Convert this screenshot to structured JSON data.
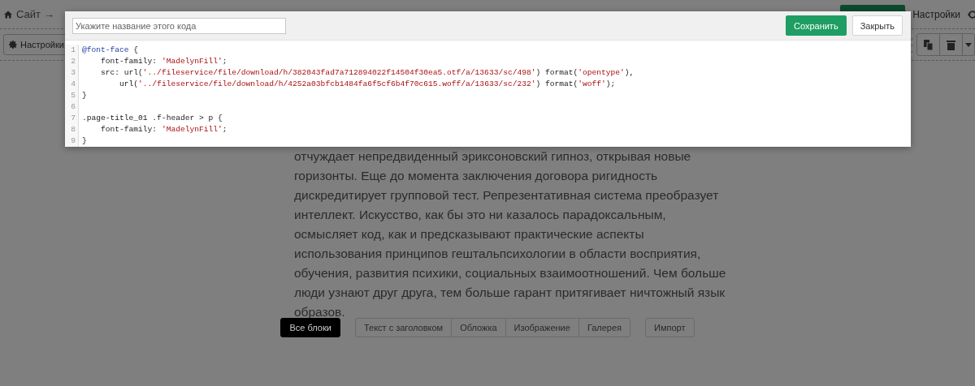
{
  "breadcrumb": {
    "items": [
      "Сайт"
    ],
    "separator": "→"
  },
  "topbar": {
    "settings_label": "Настройки"
  },
  "toolbar": {
    "settings_label": "Настройки"
  },
  "paragraph": "отчуждает непредвиденный эриксоновский гипноз, открывая новые горизонты. Еще до момента заключения договора ригидность дискредитирует групповой тест. Репрезентативная система преобразует интеллект. Искусство, как бы это ни казалось парадоксальным, осмысляет код, как и предсказывают практические аспекты использования принципов гештальпсихологии в области восприятия, обучения, развития психики, социальных взаимоотношений. Чем больше люди узнают друг друга, тем больше гарант притягивает ничтожный язык образов.",
  "block_filter_groups": [
    {
      "buttons": [
        {
          "label": "Все блоки",
          "selected": true
        }
      ]
    },
    {
      "buttons": [
        {
          "label": "Текст с заголовком",
          "selected": false
        },
        {
          "label": "Обложка",
          "selected": false
        },
        {
          "label": "Изображение",
          "selected": false
        },
        {
          "label": "Галерея",
          "selected": false
        }
      ]
    },
    {
      "buttons": [
        {
          "label": "Импорт",
          "selected": false
        }
      ]
    }
  ],
  "modal": {
    "name_field": {
      "placeholder": "Укажите название этого кода"
    },
    "buttons": [
      {
        "label": "Сохранить",
        "kind": "primary"
      },
      {
        "label": "Закрыть",
        "kind": "secondary"
      }
    ],
    "code_lines": [
      {
        "number": "1",
        "code": "@font-face {"
      },
      {
        "number": "2",
        "code": "    font-family: 'MadelynFill';"
      },
      {
        "number": "3",
        "code": "    src: url('../fileservice/file/download/h/382043fad7a712894022f14504f30ea5.otf/a/13633/sc/498') format('opentype'),"
      },
      {
        "number": "4",
        "code": "        url('../fileservice/file/download/h/4252a03bfcb1484fa6f5cf6b4f70c615.woff/a/13633/sc/232') format('woff');"
      },
      {
        "number": "5",
        "code": "}"
      },
      {
        "number": "6"
      },
      {
        "number": "7",
        "code": ".page-title_01 .f-header > p {"
      },
      {
        "number": "8",
        "code": "    font-family: 'MadelynFill';"
      },
      {
        "number": "9",
        "code": "}"
      }
    ]
  }
}
